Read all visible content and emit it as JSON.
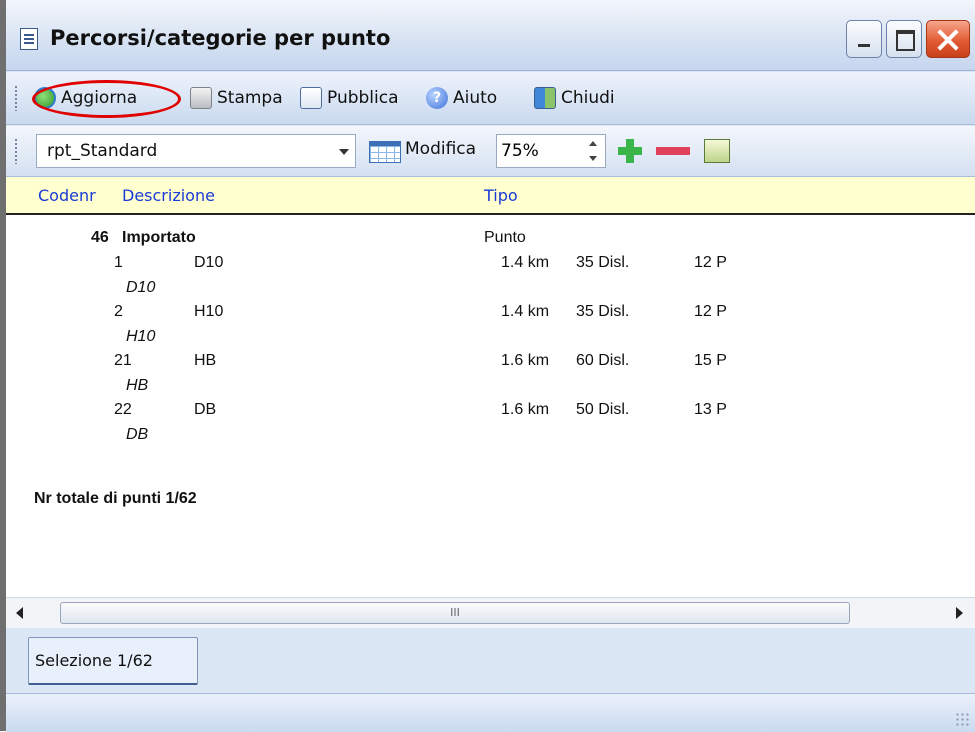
{
  "window": {
    "title": "Percorsi/categorie per punto"
  },
  "toolbar": {
    "refresh_label": "Aggiorna",
    "print_label": "Stampa",
    "publish_label": "Pubblica",
    "help_label": "Aiuto",
    "close_label": "Chiudi"
  },
  "report_toolbar": {
    "layout_value": "rpt_Standard",
    "edit_label": "Modifica",
    "zoom_value": "75%"
  },
  "columns": {
    "code": "Codenr",
    "description": "Descrizione",
    "type": "Tipo"
  },
  "group": {
    "code": "46",
    "name": "Importato",
    "type": "Punto"
  },
  "rows": [
    {
      "num": "1",
      "code": "D10",
      "dist": "1.4 km",
      "disl": "35 Disl.",
      "points": "12 P",
      "sub": "D10"
    },
    {
      "num": "2",
      "code": "H10",
      "dist": "1.4 km",
      "disl": "35 Disl.",
      "points": "12 P",
      "sub": "H10"
    },
    {
      "num": "21",
      "code": "HB",
      "dist": "1.6 km",
      "disl": "60 Disl.",
      "points": "15 P",
      "sub": "HB"
    },
    {
      "num": "22",
      "code": "DB",
      "dist": "1.6 km",
      "disl": "50 Disl.",
      "points": "13 P",
      "sub": "DB"
    }
  ],
  "total_label": "Nr totale di punti 1/62",
  "scroll": {
    "thumb_grip": "III"
  },
  "tabs": [
    {
      "label": "Selezione 1/62"
    }
  ],
  "colors": {
    "header_bg": "#ffffd0",
    "header_text": "#1a3bd6",
    "highlight": "#e00000"
  },
  "icons": [
    "document-icon",
    "refresh-icon",
    "print-icon",
    "publish-icon",
    "help-icon",
    "close-app-icon",
    "grid-icon",
    "plus-icon",
    "minus-icon",
    "export-icon"
  ]
}
